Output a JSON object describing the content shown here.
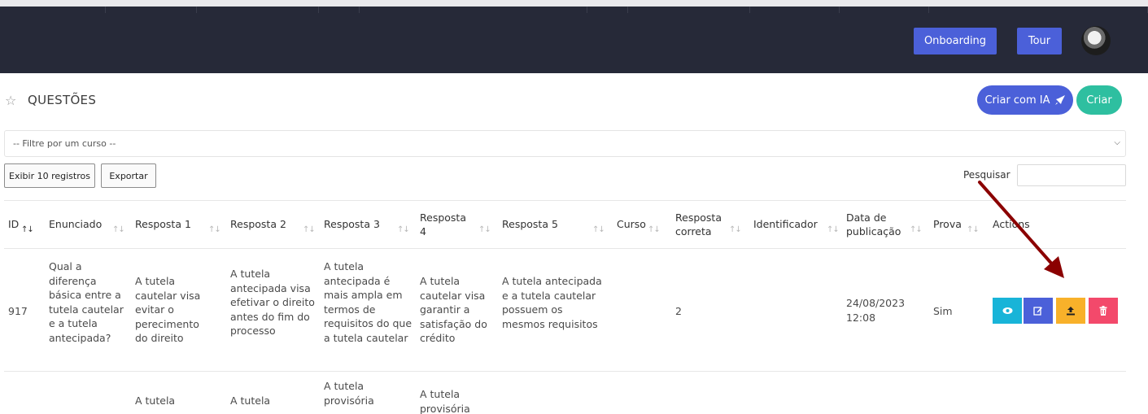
{
  "header": {
    "onboarding_label": "Onboarding",
    "tour_label": "Tour"
  },
  "page": {
    "title": "QUESTÕES",
    "create_ai_label": "Criar com IA",
    "create_label": "Criar"
  },
  "filter": {
    "placeholder": "-- Filtre por um curso --"
  },
  "toolbar": {
    "show_records_label": "Exibir 10 registros",
    "export_label": "Exportar",
    "search_label": "Pesquisar",
    "search_value": ""
  },
  "table": {
    "headers": {
      "id": "ID",
      "statement": "Enunciado",
      "answer1": "Resposta 1",
      "answer2": "Resposta 2",
      "answer3": "Resposta 3",
      "answer4": "Resposta 4",
      "answer5": "Resposta 5",
      "course": "Curso",
      "correct": "Resposta correta",
      "identifier": "Identificador",
      "published": "Data de publicação",
      "exam": "Prova",
      "actions": "Actions"
    },
    "rows": [
      {
        "id": "917",
        "statement": "Qual a diferença básica entre a tutela cautelar e a tutela antecipada?",
        "answer1": "A tutela cautelar visa evitar o perecimento do direito",
        "answer2": "A tutela antecipada visa efetivar o direito antes do fim do processo",
        "answer3": "A tutela antecipada é mais ampla em termos de requisitos do que a tutela cautelar",
        "answer4": "A tutela cautelar visa garantir a satisfação do crédito",
        "answer5": "A tutela antecipada e a tutela cautelar possuem os mesmos requisitos",
        "course": "",
        "correct": "2",
        "identifier": "",
        "published": "24/08/2023 12:08",
        "exam": "Sim"
      },
      {
        "answer1": "A tutela",
        "answer2": "A tutela",
        "answer3": "A tutela provisória",
        "answer4": "A tutela provisória"
      }
    ]
  },
  "colors": {
    "navbar": "#262938",
    "primary": "#4b60d9",
    "success": "#2ebfa0",
    "info": "#18b4d8",
    "warning": "#f8b12a",
    "danger": "#f3496b",
    "annotation_arrow": "#8b0000"
  }
}
